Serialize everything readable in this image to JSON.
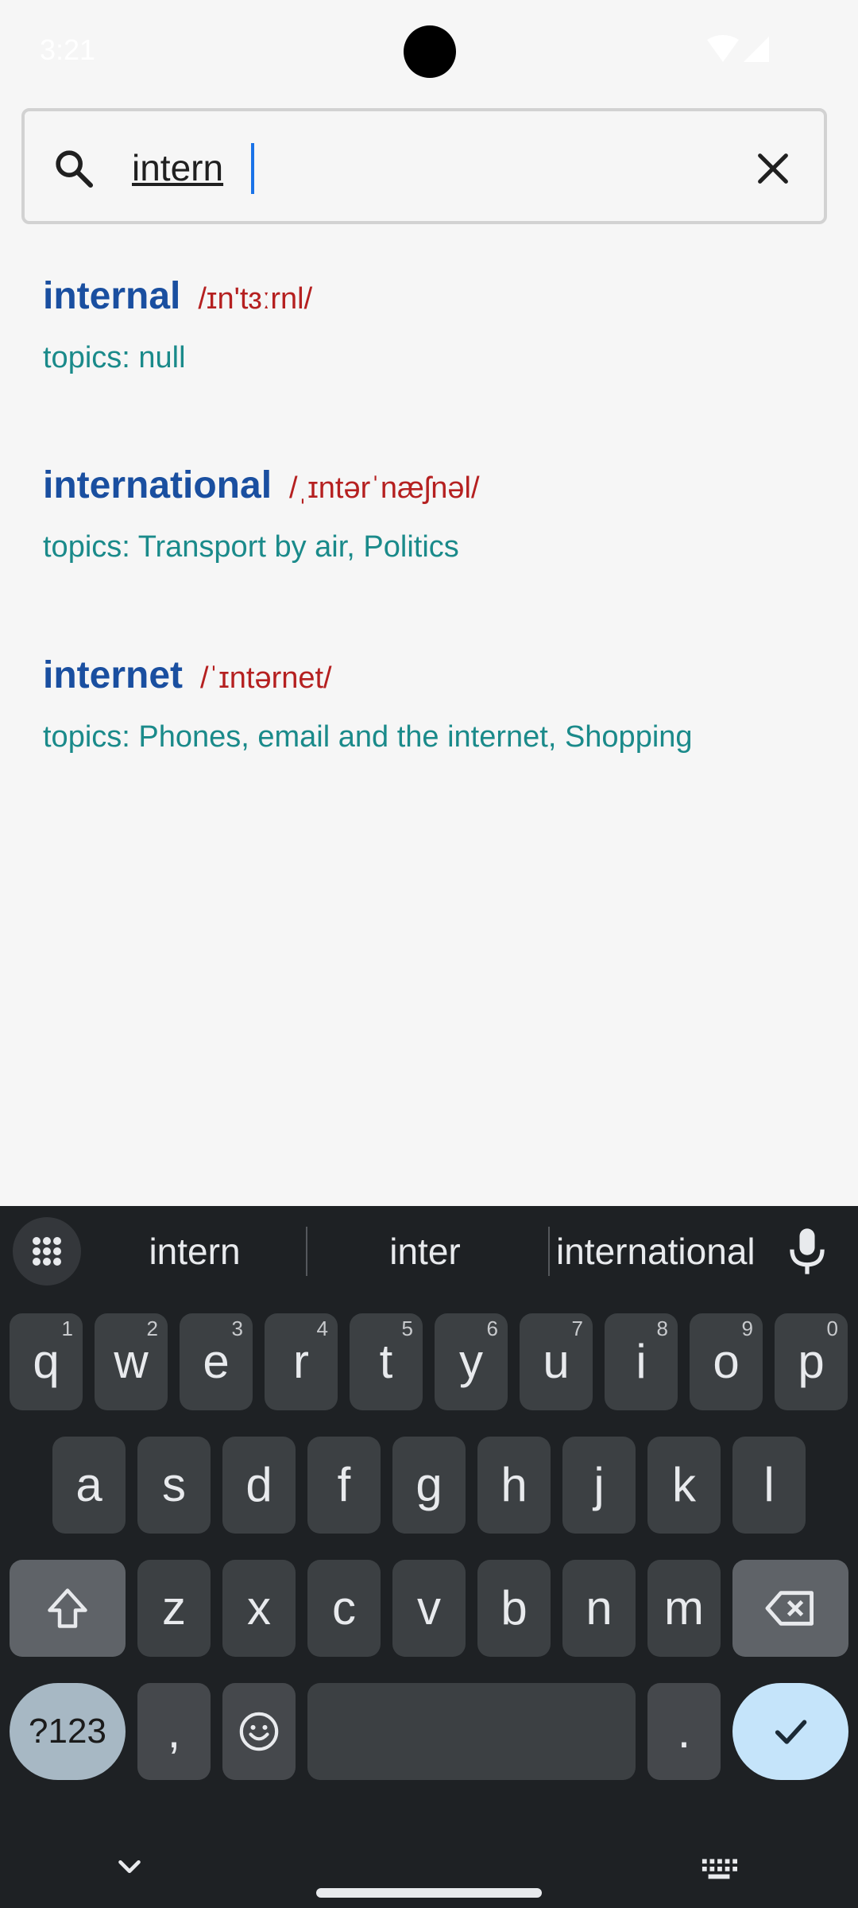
{
  "status_bar": {
    "time": "3:21"
  },
  "search": {
    "value": "intern"
  },
  "results": [
    {
      "word": "internal",
      "phonetic": "/ɪn'tɜːrnl/",
      "topics": "topics: null"
    },
    {
      "word": "international",
      "phonetic": "/ˌɪntərˈnæʃnəl/",
      "topics": "topics: Transport by air, Politics"
    },
    {
      "word": "internet",
      "phonetic": "/ˈɪntərnet/",
      "topics": "topics: Phones, email and the internet, Shopping"
    }
  ],
  "keyboard": {
    "suggestions": [
      "intern",
      "inter",
      "international"
    ],
    "row1": [
      {
        "k": "q",
        "h": "1"
      },
      {
        "k": "w",
        "h": "2"
      },
      {
        "k": "e",
        "h": "3"
      },
      {
        "k": "r",
        "h": "4"
      },
      {
        "k": "t",
        "h": "5"
      },
      {
        "k": "y",
        "h": "6"
      },
      {
        "k": "u",
        "h": "7"
      },
      {
        "k": "i",
        "h": "8"
      },
      {
        "k": "o",
        "h": "9"
      },
      {
        "k": "p",
        "h": "0"
      }
    ],
    "row2": [
      "a",
      "s",
      "d",
      "f",
      "g",
      "h",
      "j",
      "k",
      "l"
    ],
    "row3": [
      "z",
      "x",
      "c",
      "v",
      "b",
      "n",
      "m"
    ],
    "mode_label": "?123",
    "comma": ",",
    "period": "."
  },
  "colors": {
    "word": "#1a4fa0",
    "phonetic": "#b52020",
    "topics": "#1a8a8a",
    "caret": "#1a73e8"
  }
}
